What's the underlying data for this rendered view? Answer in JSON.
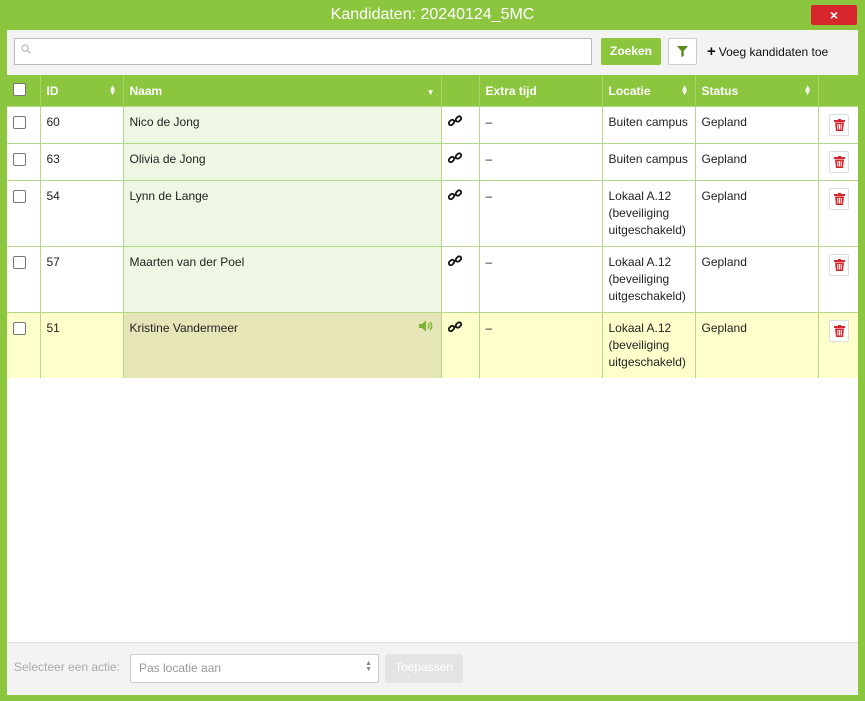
{
  "window": {
    "title": "Kandidaten: 20240124_5MC",
    "close_icon": "×"
  },
  "toolbar": {
    "search_placeholder": "",
    "search_button": "Zoeken",
    "filter_icon": "filter-icon",
    "add_button": "Voeg kandidaten toe"
  },
  "table": {
    "columns": [
      "ID",
      "Naam",
      "",
      "Extra tijd",
      "Locatie",
      "Status",
      ""
    ],
    "rows": [
      {
        "id": "60",
        "name": "Nico de Jong",
        "extra_time": "–",
        "location": "Buiten campus",
        "status": "Gepland"
      },
      {
        "id": "63",
        "name": "Olivia de Jong",
        "extra_time": "–",
        "location": "Buiten campus",
        "status": "Gepland"
      },
      {
        "id": "54",
        "name": "Lynn de Lange",
        "extra_time": "–",
        "location": "Lokaal A.12 (beveiliging uitgeschakeld)",
        "status": "Gepland"
      },
      {
        "id": "57",
        "name": "Maarten van der Poel",
        "extra_time": "–",
        "location": "Lokaal A.12 (beveiliging uitgeschakeld)",
        "status": "Gepland"
      },
      {
        "id": "51",
        "name": "Kristine Vandermeer",
        "extra_time": "–",
        "location": "Lokaal A.12 (beveiliging uitgeschakeld)",
        "status": "Gepland"
      }
    ]
  },
  "footer": {
    "label": "Selecteer een actie:",
    "selected_action": "Pas locatie aan",
    "apply_button": "Toepassen"
  },
  "colors": {
    "accent": "#8cc63f",
    "danger": "#d7262b",
    "highlight_row": "#ffffcc",
    "name_cell": "#edf7e4"
  }
}
